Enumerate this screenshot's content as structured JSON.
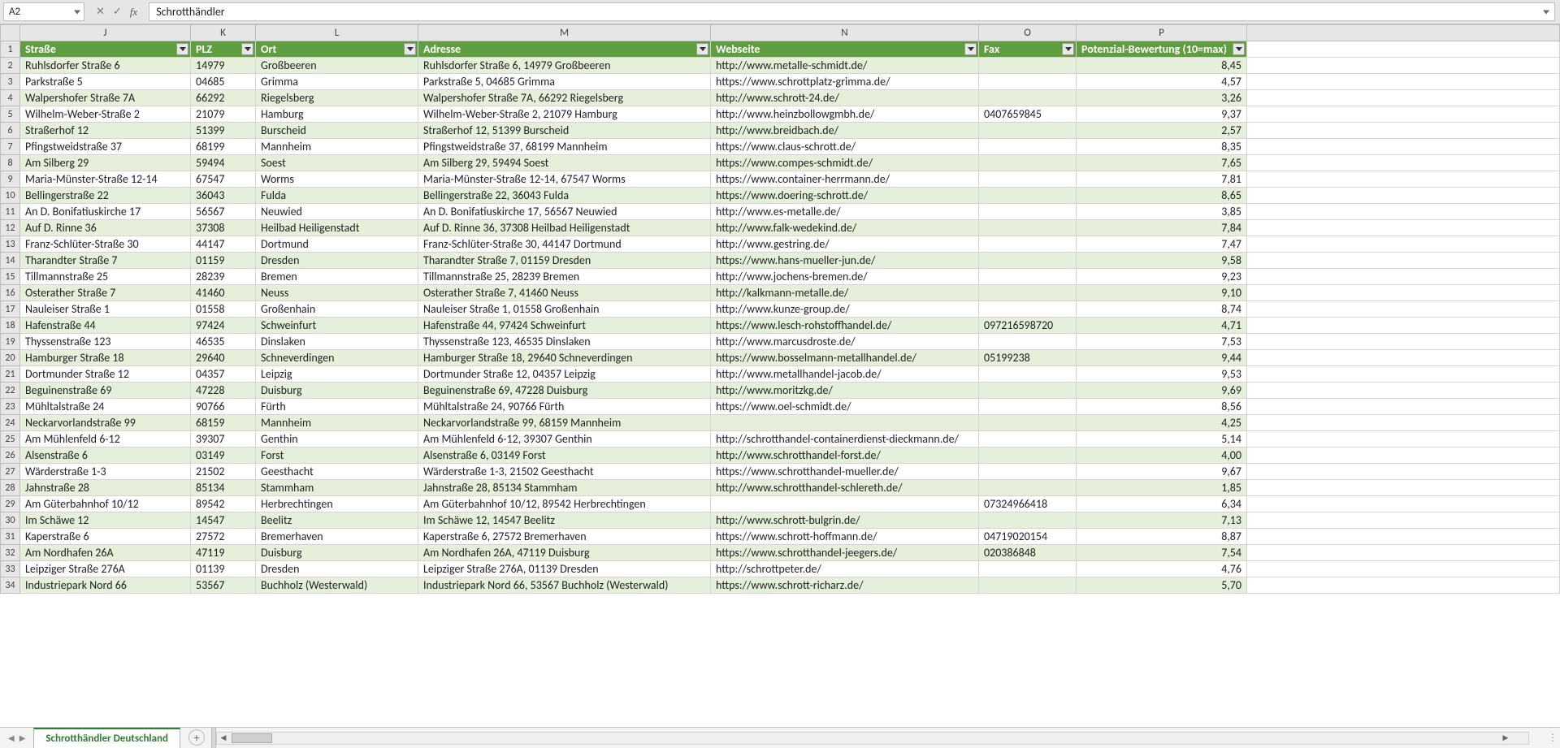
{
  "nameBox": "A2",
  "formula": "Schrotthändler",
  "sheetTab": "Schrotthändler Deutschland",
  "columns": {
    "letters": [
      "J",
      "K",
      "L",
      "M",
      "N",
      "O",
      "P",
      ""
    ],
    "headers": [
      "Straße",
      "PLZ",
      "Ort",
      "Adresse",
      "Webseite",
      "Fax",
      "Potenzial-Bewertung (10=max)"
    ]
  },
  "rows": [
    {
      "n": 2,
      "strasse": "Ruhlsdorfer Straße 6",
      "plz": "14979",
      "ort": "Großbeeren",
      "adresse": "Ruhlsdorfer Straße 6, 14979 Großbeeren",
      "web": "http://www.metalle-schmidt.de/",
      "fax": "",
      "score": "8,45"
    },
    {
      "n": 3,
      "strasse": "Parkstraße 5",
      "plz": "04685",
      "ort": "Grimma",
      "adresse": "Parkstraße 5, 04685 Grimma",
      "web": "https://www.schrottplatz-grimma.de/",
      "fax": "",
      "score": "4,57"
    },
    {
      "n": 4,
      "strasse": "Walpershofer Straße 7A",
      "plz": "66292",
      "ort": "Riegelsberg",
      "adresse": "Walpershofer Straße 7A, 66292 Riegelsberg",
      "web": "http://www.schrott-24.de/",
      "fax": "",
      "score": "3,26"
    },
    {
      "n": 5,
      "strasse": "Wilhelm-Weber-Straße 2",
      "plz": "21079",
      "ort": "Hamburg",
      "adresse": "Wilhelm-Weber-Straße 2, 21079 Hamburg",
      "web": "http://www.heinzbollowgmbh.de/",
      "fax": "0407659845",
      "score": "9,37"
    },
    {
      "n": 6,
      "strasse": "Straßerhof 12",
      "plz": "51399",
      "ort": "Burscheid",
      "adresse": "Straßerhof 12, 51399 Burscheid",
      "web": "http://www.breidbach.de/",
      "fax": "",
      "score": "2,57"
    },
    {
      "n": 7,
      "strasse": "Pfingstweidstraße 37",
      "plz": "68199",
      "ort": "Mannheim",
      "adresse": "Pfingstweidstraße 37, 68199 Mannheim",
      "web": "https://www.claus-schrott.de/",
      "fax": "",
      "score": "8,35"
    },
    {
      "n": 8,
      "strasse": "Am Silberg 29",
      "plz": "59494",
      "ort": "Soest",
      "adresse": "Am Silberg 29, 59494 Soest",
      "web": "https://www.compes-schmidt.de/",
      "fax": "",
      "score": "7,65"
    },
    {
      "n": 9,
      "strasse": "Maria-Münster-Straße 12-14",
      "plz": "67547",
      "ort": "Worms",
      "adresse": "Maria-Münster-Straße 12-14, 67547 Worms",
      "web": "https://www.container-herrmann.de/",
      "fax": "",
      "score": "7,81"
    },
    {
      "n": 10,
      "strasse": "Bellingerstraße 22",
      "plz": "36043",
      "ort": "Fulda",
      "adresse": "Bellingerstraße 22, 36043 Fulda",
      "web": "https://www.doering-schrott.de/",
      "fax": "",
      "score": "8,65"
    },
    {
      "n": 11,
      "strasse": "An D. Bonifatiuskirche 17",
      "plz": "56567",
      "ort": "Neuwied",
      "adresse": "An D. Bonifatiuskirche 17, 56567 Neuwied",
      "web": "http://www.es-metalle.de/",
      "fax": "",
      "score": "3,85"
    },
    {
      "n": 12,
      "strasse": "Auf D. Rinne 36",
      "plz": "37308",
      "ort": "Heilbad Heiligenstadt",
      "adresse": "Auf D. Rinne 36, 37308 Heilbad Heiligenstadt",
      "web": "http://www.falk-wedekind.de/",
      "fax": "",
      "score": "7,84"
    },
    {
      "n": 13,
      "strasse": "Franz-Schlüter-Straße 30",
      "plz": "44147",
      "ort": "Dortmund",
      "adresse": "Franz-Schlüter-Straße 30, 44147 Dortmund",
      "web": "http://www.gestring.de/",
      "fax": "",
      "score": "7,47"
    },
    {
      "n": 14,
      "strasse": "Tharandter Straße 7",
      "plz": "01159",
      "ort": "Dresden",
      "adresse": "Tharandter Straße 7, 01159 Dresden",
      "web": "https://www.hans-mueller-jun.de/",
      "fax": "",
      "score": "9,58"
    },
    {
      "n": 15,
      "strasse": "Tillmannstraße 25",
      "plz": "28239",
      "ort": "Bremen",
      "adresse": "Tillmannstraße 25, 28239 Bremen",
      "web": "http://www.jochens-bremen.de/",
      "fax": "",
      "score": "9,23"
    },
    {
      "n": 16,
      "strasse": "Osterather Straße 7",
      "plz": "41460",
      "ort": "Neuss",
      "adresse": "Osterather Straße 7, 41460 Neuss",
      "web": "http://kalkmann-metalle.de/",
      "fax": "",
      "score": "9,10"
    },
    {
      "n": 17,
      "strasse": "Nauleiser Straße 1",
      "plz": "01558",
      "ort": "Großenhain",
      "adresse": "Nauleiser Straße 1, 01558 Großenhain",
      "web": "http://www.kunze-group.de/",
      "fax": "",
      "score": "8,74"
    },
    {
      "n": 18,
      "strasse": "Hafenstraße 44",
      "plz": "97424",
      "ort": "Schweinfurt",
      "adresse": "Hafenstraße 44, 97424 Schweinfurt",
      "web": "https://www.lesch-rohstoffhandel.de/",
      "fax": "097216598720",
      "score": "4,71"
    },
    {
      "n": 19,
      "strasse": "Thyssenstraße 123",
      "plz": "46535",
      "ort": "Dinslaken",
      "adresse": "Thyssenstraße 123, 46535 Dinslaken",
      "web": "http://www.marcusdroste.de/",
      "fax": "",
      "score": "7,53"
    },
    {
      "n": 20,
      "strasse": "Hamburger Straße 18",
      "plz": "29640",
      "ort": "Schneverdingen",
      "adresse": "Hamburger Straße 18, 29640 Schneverdingen",
      "web": "https://www.bosselmann-metallhandel.de/",
      "fax": "05199238",
      "score": "9,44"
    },
    {
      "n": 21,
      "strasse": "Dortmunder Straße 12",
      "plz": "04357",
      "ort": "Leipzig",
      "adresse": "Dortmunder Straße 12, 04357 Leipzig",
      "web": "http://www.metallhandel-jacob.de/",
      "fax": "",
      "score": "9,53"
    },
    {
      "n": 22,
      "strasse": "Beguinenstraße 69",
      "plz": "47228",
      "ort": "Duisburg",
      "adresse": "Beguinenstraße 69, 47228 Duisburg",
      "web": "http://www.moritzkg.de/",
      "fax": "",
      "score": "9,69"
    },
    {
      "n": 23,
      "strasse": "Mühltalstraße 24",
      "plz": "90766",
      "ort": "Fürth",
      "adresse": "Mühltalstraße 24, 90766 Fürth",
      "web": "https://www.oel-schmidt.de/",
      "fax": "",
      "score": "8,56"
    },
    {
      "n": 24,
      "strasse": "Neckarvorlandstraße 99",
      "plz": "68159",
      "ort": "Mannheim",
      "adresse": "Neckarvorlandstraße 99, 68159 Mannheim",
      "web": "",
      "fax": "",
      "score": "4,25"
    },
    {
      "n": 25,
      "strasse": "Am Mühlenfeld 6-12",
      "plz": "39307",
      "ort": "Genthin",
      "adresse": "Am Mühlenfeld 6-12, 39307 Genthin",
      "web": "http://schrotthandel-containerdienst-dieckmann.de/",
      "fax": "",
      "score": "5,14"
    },
    {
      "n": 26,
      "strasse": "Alsenstraße 6",
      "plz": "03149",
      "ort": "Forst",
      "adresse": "Alsenstraße 6, 03149 Forst",
      "web": "http://www.schrotthandel-forst.de/",
      "fax": "",
      "score": "4,00"
    },
    {
      "n": 27,
      "strasse": "Wärderstraße 1-3",
      "plz": "21502",
      "ort": "Geesthacht",
      "adresse": "Wärderstraße 1-3, 21502 Geesthacht",
      "web": "https://www.schrotthandel-mueller.de/",
      "fax": "",
      "score": "9,67"
    },
    {
      "n": 28,
      "strasse": "Jahnstraße 28",
      "plz": "85134",
      "ort": "Stammham",
      "adresse": "Jahnstraße 28, 85134 Stammham",
      "web": "http://www.schrotthandel-schlereth.de/",
      "fax": "",
      "score": "1,85"
    },
    {
      "n": 29,
      "strasse": "Am Güterbahnhof 10/12",
      "plz": "89542",
      "ort": "Herbrechtingen",
      "adresse": "Am Güterbahnhof 10/12, 89542 Herbrechtingen",
      "web": "",
      "fax": "07324966418",
      "score": "6,34"
    },
    {
      "n": 30,
      "strasse": "Im Schäwe 12",
      "plz": "14547",
      "ort": "Beelitz",
      "adresse": "Im Schäwe 12, 14547 Beelitz",
      "web": "http://www.schrott-bulgrin.de/",
      "fax": "",
      "score": "7,13"
    },
    {
      "n": 31,
      "strasse": "Kaperstraße 6",
      "plz": "27572",
      "ort": "Bremerhaven",
      "adresse": "Kaperstraße 6, 27572 Bremerhaven",
      "web": "https://www.schrott-hoffmann.de/",
      "fax": "04719020154",
      "score": "8,87"
    },
    {
      "n": 32,
      "strasse": "Am Nordhafen 26A",
      "plz": "47119",
      "ort": "Duisburg",
      "adresse": "Am Nordhafen 26A, 47119 Duisburg",
      "web": "https://www.schrotthandel-jeegers.de/",
      "fax": "020386848",
      "score": "7,54"
    },
    {
      "n": 33,
      "strasse": "Leipziger Straße 276A",
      "plz": "01139",
      "ort": "Dresden",
      "adresse": "Leipziger Straße 276A, 01139 Dresden",
      "web": "http://schrottpeter.de/",
      "fax": "",
      "score": "4,76"
    },
    {
      "n": 34,
      "strasse": "Industriepark Nord 66",
      "plz": "53567",
      "ort": "Buchholz (Westerwald)",
      "adresse": "Industriepark Nord 66, 53567 Buchholz (Westerwald)",
      "web": "https://www.schrott-richarz.de/",
      "fax": "",
      "score": "5,70"
    }
  ]
}
